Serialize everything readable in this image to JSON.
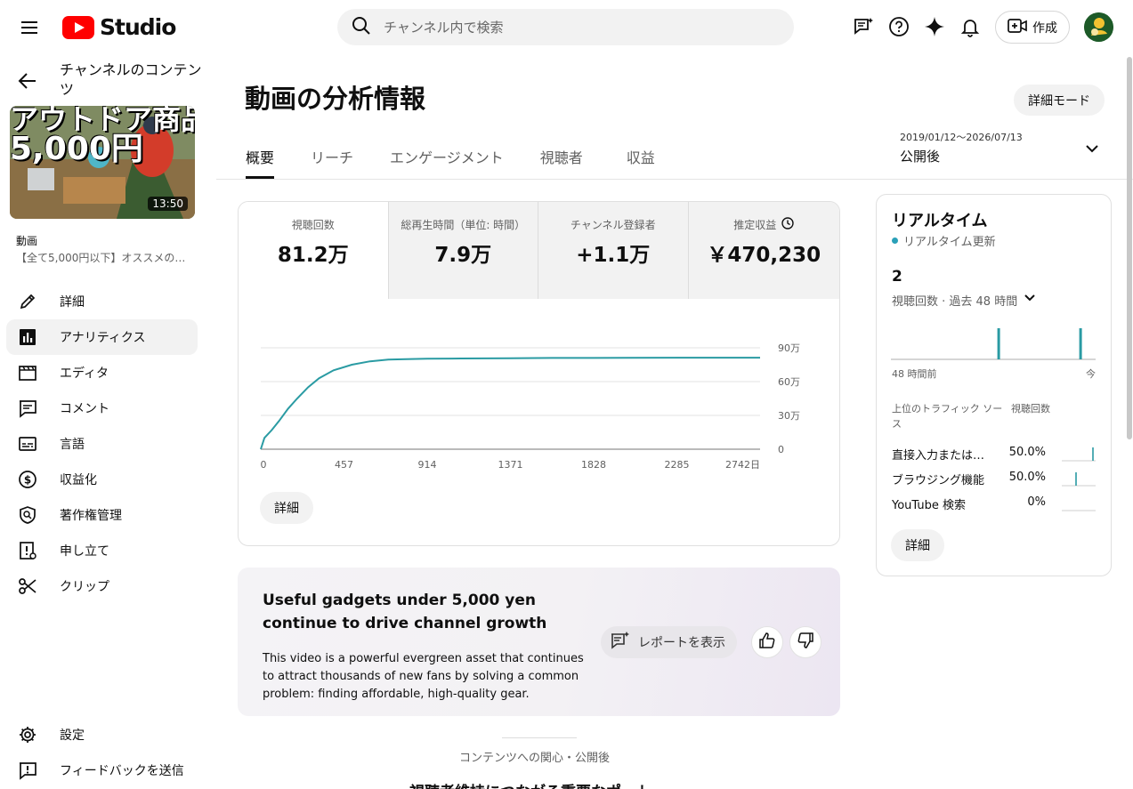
{
  "topbar": {
    "logo_text": "Studio",
    "search_placeholder": "チャンネル内で検索",
    "create_label": "作成"
  },
  "sidebar": {
    "back_title": "チャンネルのコンテンツ",
    "thumbnail": {
      "line1": "アウトドア商品",
      "line2": "5,000円",
      "duration": "13:50"
    },
    "video_label": "動画",
    "video_title": "【全て5,000円以下】オススメの…",
    "nav": [
      {
        "label": "詳細",
        "icon": "pencil-icon",
        "active": false
      },
      {
        "label": "アナリティクス",
        "icon": "analytics-icon",
        "active": true
      },
      {
        "label": "エディタ",
        "icon": "editor-icon",
        "active": false
      },
      {
        "label": "コメント",
        "icon": "comment-icon",
        "active": false
      },
      {
        "label": "言語",
        "icon": "subtitles-icon",
        "active": false
      },
      {
        "label": "収益化",
        "icon": "dollar-icon",
        "active": false
      },
      {
        "label": "著作権管理",
        "icon": "copyright-icon",
        "active": false
      },
      {
        "label": "申し立て",
        "icon": "claims-icon",
        "active": false
      },
      {
        "label": "クリップ",
        "icon": "scissors-icon",
        "active": false
      }
    ],
    "bottom": [
      {
        "label": "設定",
        "icon": "gear-icon"
      },
      {
        "label": "フィードバックを送信",
        "icon": "feedback-icon"
      }
    ]
  },
  "main": {
    "title": "動画の分析情報",
    "detail_mode_label": "詳細モード",
    "tabs": [
      "概要",
      "リーチ",
      "エンゲージメント",
      "視聴者",
      "収益"
    ],
    "date_range": {
      "range": "2019/01/12～2026/07/13",
      "name": "公開後"
    },
    "metrics": [
      {
        "label": "視聴回数",
        "value": "81.2万"
      },
      {
        "label": "総再生時間（単位: 時間）",
        "value": "7.9万"
      },
      {
        "label": "チャンネル登録者",
        "value": "+1.1万"
      },
      {
        "label": "推定収益",
        "value": "￥470,230"
      }
    ],
    "detail_label": "詳細"
  },
  "chart_data": {
    "type": "line",
    "series": [
      {
        "values_description": "cumulative views",
        "x": [
          0,
          20,
          60,
          100,
          150,
          200,
          260,
          320,
          400,
          500,
          600,
          700,
          800,
          914,
          1100,
          1371,
          1600,
          1828,
          2000,
          2285,
          2500,
          2742
        ],
        "y": [
          0,
          10,
          17,
          25,
          36,
          45,
          55,
          63,
          70,
          75,
          78,
          79.5,
          80,
          80.3,
          80.5,
          80.8,
          81,
          81,
          81.1,
          81.2,
          81.2,
          81.2
        ]
      }
    ],
    "x_ticks": [
      "0",
      "457",
      "914",
      "1371",
      "1828",
      "2285",
      "2742日"
    ],
    "y_ticks": [
      "0",
      "30万",
      "60万",
      "90万"
    ],
    "xlim": [
      0,
      2742
    ],
    "ylim": [
      0,
      90
    ],
    "grid": true,
    "color": "#2a9ba3"
  },
  "insight": {
    "title": "Useful gadgets under 5,000 yen continue to drive channel growth",
    "body": "This video is a powerful evergreen asset that continues to attract thousands of new fans by solving a common problem: finding affordable, high-quality gear.",
    "report_label": "レポートを表示"
  },
  "section": {
    "label": "コンテンツへの関心・公開後",
    "next_heading": "視聴者維持につながる重要なポート"
  },
  "realtime": {
    "title": "リアルタイム",
    "sub": "リアルタイム更新",
    "count": "2",
    "metric_label": "視聴回数 · 過去 48 時間",
    "axis_left": "48 時間前",
    "axis_right": "今",
    "spikes": [
      0.52,
      0.92
    ],
    "table_header_source": "上位のトラフィック ソース",
    "table_header_views": "視聴回数",
    "rows": [
      {
        "source": "直接入力または…",
        "pct": "50.0%",
        "spike": 0.9
      },
      {
        "source": "ブラウジング機能",
        "pct": "50.0%",
        "spike": 0.4
      },
      {
        "source": "YouTube 検索",
        "pct": "0%",
        "spike": null
      }
    ],
    "detail_label": "詳細"
  },
  "colors": {
    "accent": "#2a9ba3",
    "logo_red": "#ff0000"
  }
}
